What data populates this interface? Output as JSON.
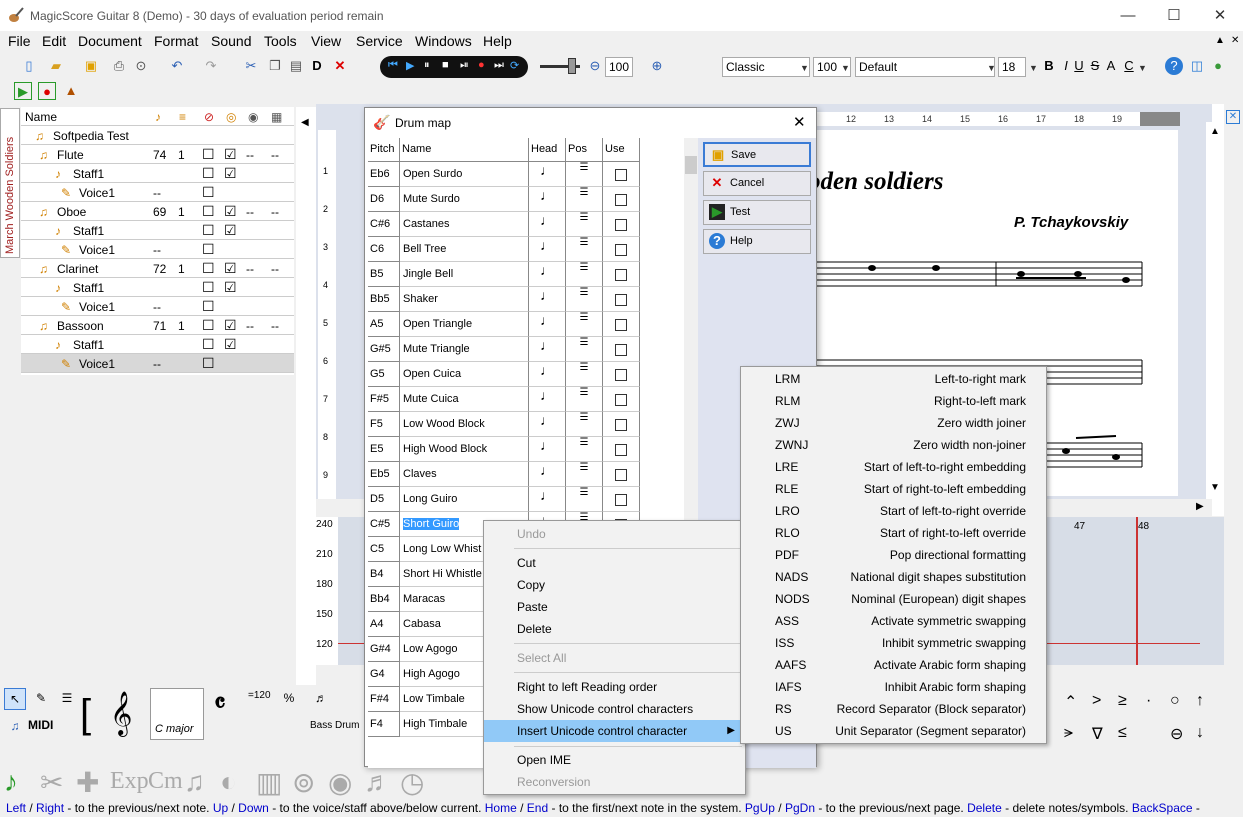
{
  "window": {
    "title": "MagicScore Guitar 8 (Demo) - 30 days of evaluation period remain",
    "minimize": "—",
    "maximize": "☐",
    "close": "✕"
  },
  "menu": [
    "File",
    "Edit",
    "Document",
    "Format",
    "Sound",
    "Tools",
    "View",
    "Service",
    "Windows",
    "Help"
  ],
  "toolbar": {
    "zoom": "100",
    "style": "Classic",
    "percent": "100",
    "font": "Default",
    "size": "18",
    "bold": "B",
    "italic": "I",
    "underline": "U",
    "strike": "S",
    "aa": "A",
    "color": "C",
    "d_label": "D"
  },
  "side_tab": "March Wooden Soldiers",
  "tree": {
    "col_name": "Name",
    "rows": [
      {
        "label": "Softpedia Test",
        "a": "",
        "b": "",
        "c1": "",
        "c2": "",
        "d": "",
        "e": ""
      },
      {
        "label": "Flute",
        "a": "74",
        "b": "1",
        "c1": "☐",
        "c2": "☑",
        "d": "--",
        "e": "--"
      },
      {
        "label": "Staff1",
        "a": "",
        "b": "",
        "c1": "☐",
        "c2": "☑",
        "d": "",
        "e": ""
      },
      {
        "label": "Voice1",
        "a": "--",
        "b": "",
        "c1": "☐",
        "c2": "",
        "d": "",
        "e": ""
      },
      {
        "label": "Oboe",
        "a": "69",
        "b": "1",
        "c1": "☐",
        "c2": "☑",
        "d": "--",
        "e": "--"
      },
      {
        "label": "Staff1",
        "a": "",
        "b": "",
        "c1": "☐",
        "c2": "☑",
        "d": "",
        "e": ""
      },
      {
        "label": "Voice1",
        "a": "--",
        "b": "",
        "c1": "☐",
        "c2": "",
        "d": "",
        "e": ""
      },
      {
        "label": "Clarinet",
        "a": "72",
        "b": "1",
        "c1": "☐",
        "c2": "☑",
        "d": "--",
        "e": "--"
      },
      {
        "label": "Staff1",
        "a": "",
        "b": "",
        "c1": "☐",
        "c2": "☑",
        "d": "",
        "e": ""
      },
      {
        "label": "Voice1",
        "a": "--",
        "b": "",
        "c1": "☐",
        "c2": "",
        "d": "",
        "e": ""
      },
      {
        "label": "Bassoon",
        "a": "71",
        "b": "1",
        "c1": "☐",
        "c2": "☑",
        "d": "--",
        "e": "--"
      },
      {
        "label": "Staff1",
        "a": "",
        "b": "",
        "c1": "☐",
        "c2": "☑",
        "d": "",
        "e": ""
      },
      {
        "label": "Voice1",
        "a": "--",
        "b": "",
        "c1": "☐",
        "c2": "",
        "d": "",
        "e": ""
      }
    ]
  },
  "score": {
    "title": "oden soldiers",
    "composer": "P. Tchaykovskiy",
    "ruler": [
      "12",
      "13",
      "14",
      "15",
      "16",
      "17",
      "18",
      "19"
    ],
    "left_ruler": [
      "1",
      "2",
      "3",
      "4",
      "5",
      "6",
      "7",
      "8",
      "9"
    ]
  },
  "lower": {
    "scale": [
      "240",
      "210",
      "180",
      "150",
      "120"
    ],
    "bars": [
      "47",
      "48"
    ]
  },
  "drum": {
    "title": "Drum map",
    "headers": {
      "pitch": "Pitch",
      "name": "Name",
      "head": "Head",
      "pos": "Pos",
      "use": "Use"
    },
    "rows": [
      {
        "pitch": "Eb6",
        "name": "Open Surdo"
      },
      {
        "pitch": "D6",
        "name": "Mute Surdo"
      },
      {
        "pitch": "C#6",
        "name": "Castanes"
      },
      {
        "pitch": "C6",
        "name": "Bell Tree"
      },
      {
        "pitch": "B5",
        "name": "Jingle Bell"
      },
      {
        "pitch": "Bb5",
        "name": "Shaker"
      },
      {
        "pitch": "A5",
        "name": "Open Triangle"
      },
      {
        "pitch": "G#5",
        "name": "Mute Triangle"
      },
      {
        "pitch": "G5",
        "name": "Open Cuica"
      },
      {
        "pitch": "F#5",
        "name": "Mute Cuica"
      },
      {
        "pitch": "F5",
        "name": "Low Wood Block"
      },
      {
        "pitch": "E5",
        "name": "High Wood Block"
      },
      {
        "pitch": "Eb5",
        "name": "Claves"
      },
      {
        "pitch": "D5",
        "name": "Long Guiro"
      },
      {
        "pitch": "C#5",
        "name": "Short Guiro"
      },
      {
        "pitch": "C5",
        "name": "Long Low Whist"
      },
      {
        "pitch": "B4",
        "name": "Short Hi Whistle"
      },
      {
        "pitch": "Bb4",
        "name": "Maracas"
      },
      {
        "pitch": "A4",
        "name": "Cabasa"
      },
      {
        "pitch": "G#4",
        "name": "Low Agogo"
      },
      {
        "pitch": "G4",
        "name": "High Agogo"
      },
      {
        "pitch": "F#4",
        "name": "Low Timbale"
      },
      {
        "pitch": "F4",
        "name": "High Timbale"
      }
    ],
    "buttons": {
      "save": "Save",
      "cancel": "Cancel",
      "test": "Test",
      "help": "Help"
    }
  },
  "context_menu": {
    "undo": "Undo",
    "cut": "Cut",
    "copy": "Copy",
    "paste": "Paste",
    "delete": "Delete",
    "select_all": "Select All",
    "rtl": "Right to left Reading order",
    "show_unicode": "Show Unicode control characters",
    "insert_unicode": "Insert Unicode control character",
    "open_ime": "Open IME",
    "reconversion": "Reconversion"
  },
  "submenu": [
    {
      "code": "LRM",
      "desc": "Left-to-right mark"
    },
    {
      "code": "RLM",
      "desc": "Right-to-left mark"
    },
    {
      "code": "ZWJ",
      "desc": "Zero width joiner"
    },
    {
      "code": "ZWNJ",
      "desc": "Zero width non-joiner"
    },
    {
      "code": "LRE",
      "desc": "Start of left-to-right embedding"
    },
    {
      "code": "RLE",
      "desc": "Start of right-to-left embedding"
    },
    {
      "code": "LRO",
      "desc": "Start of left-to-right override"
    },
    {
      "code": "RLO",
      "desc": "Start of right-to-left override"
    },
    {
      "code": "PDF",
      "desc": "Pop directional formatting"
    },
    {
      "code": "NADS",
      "desc": "National digit shapes substitution"
    },
    {
      "code": "NODS",
      "desc": "Nominal (European) digit shapes"
    },
    {
      "code": "ASS",
      "desc": "Activate symmetric swapping"
    },
    {
      "code": "ISS",
      "desc": "Inhibit symmetric swapping"
    },
    {
      "code": "AAFS",
      "desc": "Activate Arabic form shaping"
    },
    {
      "code": "IAFS",
      "desc": "Inhibit Arabic form shaping"
    },
    {
      "code": "RS",
      "desc": "Record Separator (Block separator)"
    },
    {
      "code": "US",
      "desc": "Unit Separator (Segment separator)"
    }
  ],
  "palette": {
    "midi": "MIDI",
    "cmajor": "C major",
    "tempo": "=120",
    "bass_drum": "Bass Drum"
  },
  "bottom_labels": {
    "exp": "Exp",
    "cm": "Cm"
  },
  "status": [
    {
      "k": "Left",
      "t": " / "
    },
    {
      "k": "Right",
      "t": " - to the previous/next note. "
    },
    {
      "k": "Up",
      "t": " / "
    },
    {
      "k": "Down",
      "t": " - to the voice/staff above/below current. "
    },
    {
      "k": "Home",
      "t": " / "
    },
    {
      "k": "End",
      "t": " - to the first/next note in the system. "
    },
    {
      "k": "PgUp",
      "t": " / "
    },
    {
      "k": "PgDn",
      "t": " - to the previous/next page. "
    },
    {
      "k": "Delete",
      "t": " - delete notes/symbols. "
    },
    {
      "k": "BackSpace",
      "t": " -"
    }
  ]
}
